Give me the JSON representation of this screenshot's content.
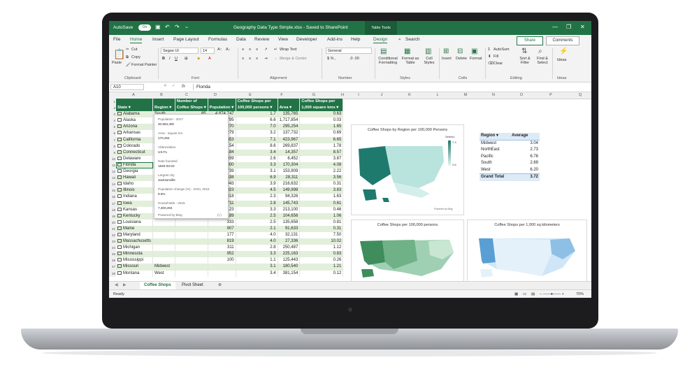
{
  "titlebar": {
    "autosave_label": "AutoSave",
    "autosave_state": "On",
    "doc_title": "Geography Data Type Simple.xlsx  -  Saved to SharePoint",
    "context_tab": "Table Tools",
    "user_initial": "",
    "controls": {
      "minimize": "—",
      "restore": "❐",
      "close": "✕"
    }
  },
  "ribbon_tabs": [
    "File",
    "Home",
    "Insert",
    "Page Layout",
    "Formulas",
    "Data",
    "Review",
    "View",
    "Developer",
    "Add-ins",
    "Help",
    "Design"
  ],
  "search": {
    "label": "Search"
  },
  "share_label": "Share",
  "comments_label": "Comments",
  "ribbon": {
    "clipboard": {
      "paste": "Paste",
      "cut": "Cut",
      "copy": "Copy",
      "format_painter": "Format Painter",
      "group": "Clipboard"
    },
    "font": {
      "name": "Segoe UI",
      "size": "14",
      "group": "Font"
    },
    "alignment": {
      "wrap": "Wrap Text",
      "merge": "Merge & Center",
      "group": "Alignment"
    },
    "number": {
      "format": "General",
      "group": "Number"
    },
    "styles": {
      "conditional": "Conditional Formatting",
      "format_table": "Format as Table",
      "cell_styles": "Cell Styles",
      "group": "Styles"
    },
    "cells": {
      "insert": "Insert",
      "delete": "Delete",
      "format": "Format",
      "group": "Cells"
    },
    "editing": {
      "autosum": "AutoSum",
      "fill": "Fill",
      "clear": "Clear",
      "sort": "Sort & Filter",
      "find": "Find & Select",
      "group": "Editing"
    },
    "ideas": {
      "label": "Ideas",
      "group": "Ideas"
    }
  },
  "formula_bar": {
    "cell": "A10",
    "fx": "fx",
    "value": "Florida"
  },
  "columns": [
    "A",
    "B",
    "C",
    "D",
    "E",
    "F",
    "G",
    "H",
    "I",
    "J",
    "K",
    "L",
    "M",
    "N",
    "O",
    "P",
    "Q",
    "R",
    "S",
    "T"
  ],
  "rows": [
    "1",
    "2",
    "3",
    "4",
    "5",
    "6",
    "7",
    "8",
    "9",
    "10",
    "11",
    "12",
    "13",
    "14",
    "15",
    "16",
    "17",
    "18",
    "19",
    "20",
    "21",
    "22",
    "23",
    "24",
    "25",
    "26",
    "27",
    "28"
  ],
  "table": {
    "headers_top": [
      "",
      "",
      "Number of",
      "",
      "Coffee Shops per",
      "",
      "Coffee Shops per"
    ],
    "headers": [
      "State",
      "Region",
      "Coffee Shops",
      "Population",
      "100,000 persons",
      "Area",
      "1,000 square kms"
    ],
    "rows": [
      [
        "Alabama",
        "South",
        "85",
        "4,874,747",
        "1.7",
        "135,765",
        "0.63"
      ],
      [
        "Alaska",
        "Pacific",
        "49",
        "739,795",
        "6.6",
        "1,717,854",
        "0.03"
      ],
      [
        "Arizona",
        "West",
        "488",
        "7,016,270",
        "7.0",
        "295,254",
        "1.65"
      ],
      [
        "Arkansas",
        "South",
        "95",
        "3,004,279",
        "3.2",
        "137,732",
        "0.69"
      ],
      [
        "California",
        "Pacific",
        "2821",
        "39,536,653",
        "7.1",
        "423,967",
        "6.65"
      ],
      [
        "Colorado",
        "West",
        "481",
        "5,607,154",
        "8.6",
        "269,837",
        "1.78"
      ],
      [
        "Connecticut",
        "NorthEast",
        "123",
        "3,588,184",
        "3.4",
        "14,357",
        "8.57"
      ],
      [
        "Delaware",
        "South",
        "25",
        "961,939",
        "2.6",
        "6,452",
        "3.87"
      ],
      [
        "Florida",
        "",
        "",
        "400",
        "3.3",
        "170,304",
        "4.08"
      ],
      [
        "Georgia",
        "",
        "",
        "739",
        "3.1",
        "153,909",
        "2.22"
      ],
      [
        "Hawaii",
        "",
        "",
        "538",
        "6.9",
        "28,311",
        "3.56"
      ],
      [
        "Idaho",
        "",
        "",
        "943",
        "3.9",
        "216,632",
        "0.31"
      ],
      [
        "Illinois",
        "",
        "",
        "023",
        "4.5",
        "149,998",
        "3.83"
      ],
      [
        "Indiana",
        "",
        "",
        "818",
        "2.3",
        "94,326",
        "1.63"
      ],
      [
        "Iowa",
        "",
        "",
        "711",
        "2.8",
        "145,743",
        "0.61"
      ],
      [
        "Kansas",
        "",
        "",
        "123",
        "3.3",
        "213,100",
        "0.46"
      ],
      [
        "Kentucky",
        "",
        "",
        "189",
        "2.5",
        "104,656",
        "1.06"
      ],
      [
        "Louisiana",
        "",
        "",
        "333",
        "2.5",
        "135,658",
        "0.81"
      ],
      [
        "Maine",
        "",
        "",
        "907",
        "2.1",
        "91,633",
        "0.31"
      ],
      [
        "Maryland",
        "",
        "",
        "177",
        "4.0",
        "32,131",
        "7.50"
      ],
      [
        "Massachusetts",
        "",
        "",
        "819",
        "4.0",
        "27,336",
        "10.02"
      ],
      [
        "Michigan",
        "",
        "",
        "311",
        "2.8",
        "250,487",
        "1.12"
      ],
      [
        "Minnesota",
        "",
        "",
        "952",
        "3.3",
        "225,163",
        "0.83"
      ],
      [
        "Mississippi",
        "",
        "",
        "100",
        "1.1",
        "125,443",
        "0.26"
      ],
      [
        "Missouri",
        "Midwest",
        "",
        "",
        "3.1",
        "180,540",
        "1.21"
      ],
      [
        "Montana",
        "West",
        "",
        "",
        "3.4",
        "381,154",
        "0.12"
      ]
    ]
  },
  "card": {
    "fields": [
      {
        "label": "Population - 2017",
        "value": "20,984,400"
      },
      {
        "label": "Area - square km",
        "value": "170,304"
      },
      {
        "label": "Abbreviation",
        "value": "US-FL"
      },
      {
        "label": "Date founded",
        "value": "1845-03-03"
      },
      {
        "label": "Largest city",
        "value": "Jacksonville"
      },
      {
        "label": "Population change (%) - 2010, 2016",
        "value": "9.6%"
      },
      {
        "label": "Households - 2015",
        "value": "7,300,494"
      }
    ],
    "footer": "Powered by Bing",
    "count": "(+)"
  },
  "charts": {
    "top": {
      "title": "Coffee Shops by Region per 100,000 Persons",
      "legend_title": "Series1",
      "legend_max": "7.3",
      "legend_min": "2.6",
      "credit": "Powered by Bing"
    },
    "bottom_left": {
      "title": "Coffee Shops per 100,000 persons"
    },
    "bottom_right": {
      "title": "Coffee Shops per 1,000 sq kilometers"
    }
  },
  "pivot": {
    "headers": [
      "Region",
      "Average"
    ],
    "rows": [
      [
        "Midwest",
        "3.04"
      ],
      [
        "NorthEast",
        "2.73"
      ],
      [
        "Pacific",
        "6.76"
      ],
      [
        "South",
        "2.69"
      ],
      [
        "West",
        "6.20"
      ]
    ],
    "total": [
      "Grand Total",
      "3.72"
    ]
  },
  "sheets": [
    "Coffee Shops",
    "Pivot Sheet"
  ],
  "status": {
    "ready": "Ready",
    "zoom": "70%"
  },
  "colors": {
    "excel_green": "#217346",
    "band": "#e2efda",
    "pivot_header": "#ddebf7",
    "map_dark": "#1f7a6e",
    "map_light": "#b9e3dd"
  }
}
